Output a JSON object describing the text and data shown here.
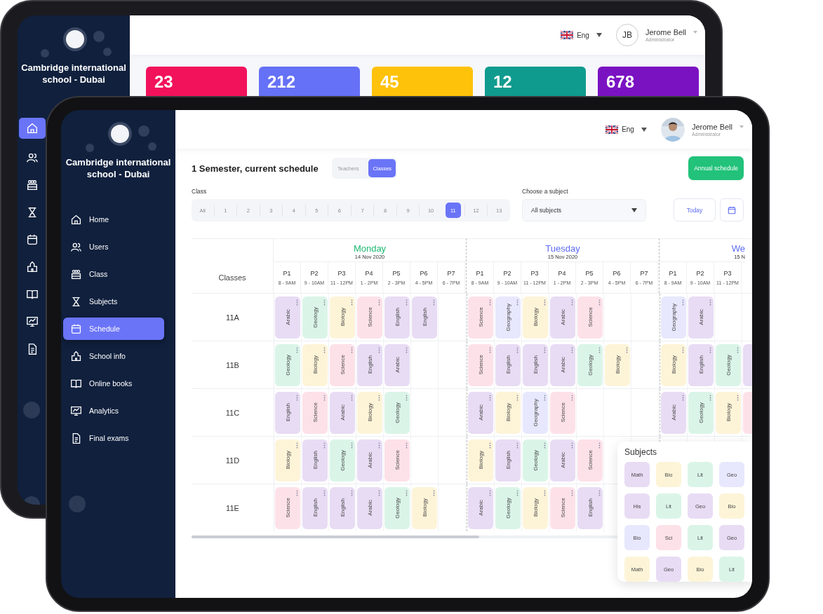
{
  "back_tablet": {
    "school_name": "Cambridge international school - Dubai",
    "nav": [
      {
        "selected": true
      },
      {
        "selected": false
      },
      {
        "selected": false
      },
      {
        "selected": false
      },
      {
        "selected": false
      },
      {
        "selected": false
      },
      {
        "selected": false
      },
      {
        "selected": false
      },
      {
        "selected": false
      }
    ],
    "language": "Eng",
    "avatar_initials": "JB",
    "user_name": "Jerome Bell",
    "user_role": "Administrator",
    "stats": [
      {
        "value": "23",
        "color": "#f2125c"
      },
      {
        "value": "212",
        "color": "#6571f6"
      },
      {
        "value": "45",
        "color": "#ffc20a"
      },
      {
        "value": "12",
        "color": "#0f9b8e"
      },
      {
        "value": "678",
        "color": "#7a12c2"
      }
    ]
  },
  "front_tablet": {
    "school_name": "Cambridge international school - Dubai",
    "nav": [
      {
        "label": "Home",
        "selected": false
      },
      {
        "label": "Users",
        "selected": false
      },
      {
        "label": "Class",
        "selected": false
      },
      {
        "label": "Subjects",
        "selected": false
      },
      {
        "label": "Schedule",
        "selected": true
      },
      {
        "label": "School info",
        "selected": false
      },
      {
        "label": "Online books",
        "selected": false
      },
      {
        "label": "Analytics",
        "selected": false
      },
      {
        "label": "Final exams",
        "selected": false
      }
    ],
    "language": "Eng",
    "user_name": "Jerome Bell",
    "user_role": "Administrator",
    "title": "1 Semester, current schedule",
    "view_toggle": [
      {
        "label": "Teachers",
        "selected": false
      },
      {
        "label": "Classes",
        "selected": true
      }
    ],
    "annual_button": "Annual schedule",
    "class_filter": {
      "label": "Class",
      "options": [
        {
          "label": "All",
          "selected": false
        },
        {
          "label": "1",
          "selected": false
        },
        {
          "label": "2",
          "selected": false
        },
        {
          "label": "3",
          "selected": false
        },
        {
          "label": "4",
          "selected": false
        },
        {
          "label": "5",
          "selected": false
        },
        {
          "label": "6",
          "selected": false
        },
        {
          "label": "7",
          "selected": false
        },
        {
          "label": "8",
          "selected": false
        },
        {
          "label": "9",
          "selected": false
        },
        {
          "label": "10",
          "selected": false
        },
        {
          "label": "11",
          "selected": true
        },
        {
          "label": "12",
          "selected": false
        },
        {
          "label": "13",
          "selected": false
        }
      ]
    },
    "subject_filter": {
      "label": "Choose a subject",
      "value": "All subjects"
    },
    "today_button": "Today",
    "schedule": {
      "classes_header": "Classes",
      "days": [
        {
          "name": "Monday",
          "date": "14 Nov 2020",
          "color": "#1fb871",
          "periods": [
            {
              "name": "P1",
              "time": "8 - 9AM"
            },
            {
              "name": "P2",
              "time": "9 - 10AM"
            },
            {
              "name": "P3",
              "time": "11 - 12PM"
            },
            {
              "name": "P4",
              "time": "1 - 2PM"
            },
            {
              "name": "P5",
              "time": "2 - 3PM"
            },
            {
              "name": "P6",
              "time": "4 - 5PM"
            },
            {
              "name": "P7",
              "time": "6 - 7PM"
            }
          ]
        },
        {
          "name": "Tuesday",
          "date": "15 Nov 2020",
          "color": "#5d6cf5",
          "periods": [
            {
              "name": "P1",
              "time": "8 - 9AM"
            },
            {
              "name": "P2",
              "time": "9 - 10AM"
            },
            {
              "name": "P3",
              "time": "11 - 12PM"
            },
            {
              "name": "P4",
              "time": "1 - 2PM"
            },
            {
              "name": "P5",
              "time": "2 - 3PM"
            },
            {
              "name": "P6",
              "time": "4 - 5PM"
            },
            {
              "name": "P7",
              "time": "6 - 7PM"
            }
          ]
        },
        {
          "name": "We",
          "date": "15 N",
          "color": "#5d6cf5",
          "periods": [
            {
              "name": "P1",
              "time": "8 - 9AM"
            },
            {
              "name": "P2",
              "time": "9 - 10AM"
            },
            {
              "name": "P3",
              "time": "11 - 12PM"
            }
          ]
        }
      ],
      "rows": [
        {
          "class": "11A",
          "days": [
            [
              {
                "subject": "Arabic",
                "color": "#e8dcf4"
              },
              {
                "subject": "Geology",
                "color": "#daf5e8"
              },
              {
                "subject": "Biology",
                "color": "#fdf4d8"
              },
              {
                "subject": "Science",
                "color": "#fde1e9"
              },
              {
                "subject": "English",
                "color": "#e8dcf4"
              },
              {
                "subject": "English",
                "color": "#e8dcf4"
              }
            ],
            [
              {
                "subject": "Science",
                "color": "#fde1e9"
              },
              {
                "subject": "Geography",
                "color": "#e7e8fd"
              },
              {
                "subject": "Biology",
                "color": "#fdf4d8"
              },
              {
                "subject": "Arabic",
                "color": "#e8dcf4"
              },
              {
                "subject": "Science",
                "color": "#fde1e9"
              }
            ],
            [
              {
                "subject": "Geography",
                "color": "#e7e8fd"
              },
              {
                "subject": "Arabic",
                "color": "#e8dcf4"
              }
            ]
          ]
        },
        {
          "class": "11B",
          "days": [
            [
              {
                "subject": "Geology",
                "color": "#daf5e8"
              },
              {
                "subject": "Biology",
                "color": "#fdf4d8"
              },
              {
                "subject": "Science",
                "color": "#fde1e9"
              },
              {
                "subject": "English",
                "color": "#e8dcf4"
              },
              {
                "subject": "Arabic",
                "color": "#e8dcf4"
              }
            ],
            [
              {
                "subject": "Science",
                "color": "#fde1e9"
              },
              {
                "subject": "English",
                "color": "#e8dcf4"
              },
              {
                "subject": "English",
                "color": "#e8dcf4"
              },
              {
                "subject": "Arabic",
                "color": "#e8dcf4"
              },
              {
                "subject": "Geology",
                "color": "#daf5e8"
              },
              {
                "subject": "Biology",
                "color": "#fdf4d8"
              }
            ],
            [
              {
                "subject": "Biology",
                "color": "#fdf4d8"
              },
              {
                "subject": "English",
                "color": "#e8dcf4"
              },
              {
                "subject": "Geology",
                "color": "#daf5e8"
              },
              {
                "color": "#e8dcf4"
              }
            ]
          ]
        },
        {
          "class": "11C",
          "days": [
            [
              {
                "subject": "English",
                "color": "#e8dcf4"
              },
              {
                "subject": "Science",
                "color": "#fde1e9"
              },
              {
                "subject": "Arabic",
                "color": "#e8dcf4"
              },
              {
                "subject": "Biology",
                "color": "#fdf4d8"
              },
              {
                "subject": "Geology",
                "color": "#daf5e8"
              }
            ],
            [
              {
                "subject": "Arabic",
                "color": "#e8dcf4"
              },
              {
                "subject": "Biology",
                "color": "#fdf4d8"
              },
              {
                "subject": "Geography",
                "color": "#e7e8fd"
              },
              {
                "subject": "Science",
                "color": "#fde1e9"
              }
            ],
            [
              {
                "subject": "Arabic",
                "color": "#e8dcf4"
              },
              {
                "subject": "Geology",
                "color": "#daf5e8"
              },
              {
                "subject": "Biology",
                "color": "#fdf4d8"
              },
              {
                "color": "#fde1e9"
              }
            ]
          ]
        },
        {
          "class": "11D",
          "days": [
            [
              {
                "subject": "Biology",
                "color": "#fdf4d8"
              },
              {
                "subject": "English",
                "color": "#e8dcf4"
              },
              {
                "subject": "Geology",
                "color": "#daf5e8"
              },
              {
                "subject": "Arabic",
                "color": "#e8dcf4"
              },
              {
                "subject": "Science",
                "color": "#fde1e9"
              }
            ],
            [
              {
                "subject": "Biology",
                "color": "#fdf4d8"
              },
              {
                "subject": "English",
                "color": "#e8dcf4"
              },
              {
                "subject": "Geology",
                "color": "#daf5e8"
              },
              {
                "subject": "Arabic",
                "color": "#e8dcf4"
              },
              {
                "subject": "Science",
                "color": "#fde1e9"
              }
            ]
          ]
        },
        {
          "class": "11E",
          "days": [
            [
              {
                "subject": "Science",
                "color": "#fde1e9"
              },
              {
                "subject": "English",
                "color": "#e8dcf4"
              },
              {
                "subject": "English",
                "color": "#e8dcf4"
              },
              {
                "subject": "Arabic",
                "color": "#e8dcf4"
              },
              {
                "subject": "Geology",
                "color": "#daf5e8"
              },
              {
                "subject": "Biology",
                "color": "#fdf4d8"
              }
            ],
            [
              {
                "subject": "Arabic",
                "color": "#e8dcf4"
              },
              {
                "subject": "Geology",
                "color": "#daf5e8"
              },
              {
                "subject": "Biology",
                "color": "#fdf4d8"
              },
              {
                "subject": "Science",
                "color": "#fde1e9"
              },
              {
                "subject": "English",
                "color": "#e8dcf4"
              }
            ]
          ]
        }
      ]
    },
    "subjects_panel": {
      "title": "Subjects",
      "items": [
        {
          "label": "Math",
          "color": "#e8dcf4"
        },
        {
          "label": "Bio",
          "color": "#fdf4d8"
        },
        {
          "label": "Lit",
          "color": "#daf5e8"
        },
        {
          "label": "Geo",
          "color": "#e7e8fd"
        },
        {
          "label": "His",
          "color": "#e8dcf4"
        },
        {
          "label": "Lit",
          "color": "#daf5e8"
        },
        {
          "label": "Geo",
          "color": "#e8dcf4"
        },
        {
          "label": "Bio",
          "color": "#fdf4d8"
        },
        {
          "label": "Bio",
          "color": "#e7e8fd"
        },
        {
          "label": "Sci",
          "color": "#fde1e9"
        },
        {
          "label": "Lit",
          "color": "#daf5e8"
        },
        {
          "label": "Geo",
          "color": "#e8dcf4"
        },
        {
          "label": "Math",
          "color": "#fdf4d8"
        },
        {
          "label": "Geo",
          "color": "#e8dcf4"
        },
        {
          "label": "Bio",
          "color": "#fdf4d8"
        },
        {
          "label": "Lit",
          "color": "#daf5e8"
        }
      ]
    }
  }
}
